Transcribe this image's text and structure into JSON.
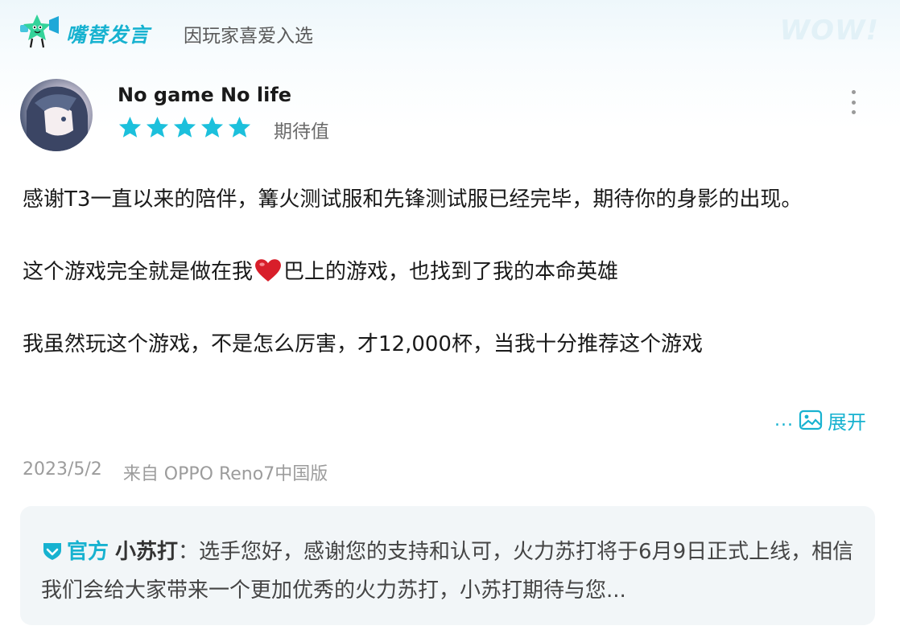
{
  "header": {
    "brand": "嘴替发言",
    "reason": "因玩家喜爱入选",
    "watermark": "WOW!"
  },
  "post": {
    "username": "No game No life",
    "stars": 5,
    "rating_label": "期待值",
    "lines": {
      "p1": "感谢T3一直以来的陪伴，篝火测试服和先锋测试服已经完毕，期待你的身影的出现。",
      "p2_before": "这个游戏完全就是做在我",
      "p2_after": "巴上的游戏，也找到了我的本命英雄",
      "p3": "我虽然玩这个游戏，不是怎么厉害，才12,000杯，当我十分推荐这个游戏"
    },
    "expand_dots": "...",
    "expand_label": "展开",
    "date": "2023/5/2",
    "device": "来自 OPPO Reno7中国版"
  },
  "reply": {
    "official_label": "官方",
    "name": "小苏打",
    "text": "：选手您好，感谢您的支持和认可，火力苏打将于6月9日正式上线，相信我们会给大家带来一个更加优秀的火力苏打，小苏打期待与您..."
  },
  "colors": {
    "accent": "#17b2d0",
    "star": "#1cc0dc",
    "heart": "#d81e2a"
  },
  "icons": [
    "mascot-logo-icon",
    "star-icon",
    "more-vertical-icon",
    "heart-emoji-icon",
    "image-icon",
    "official-badge-icon"
  ]
}
